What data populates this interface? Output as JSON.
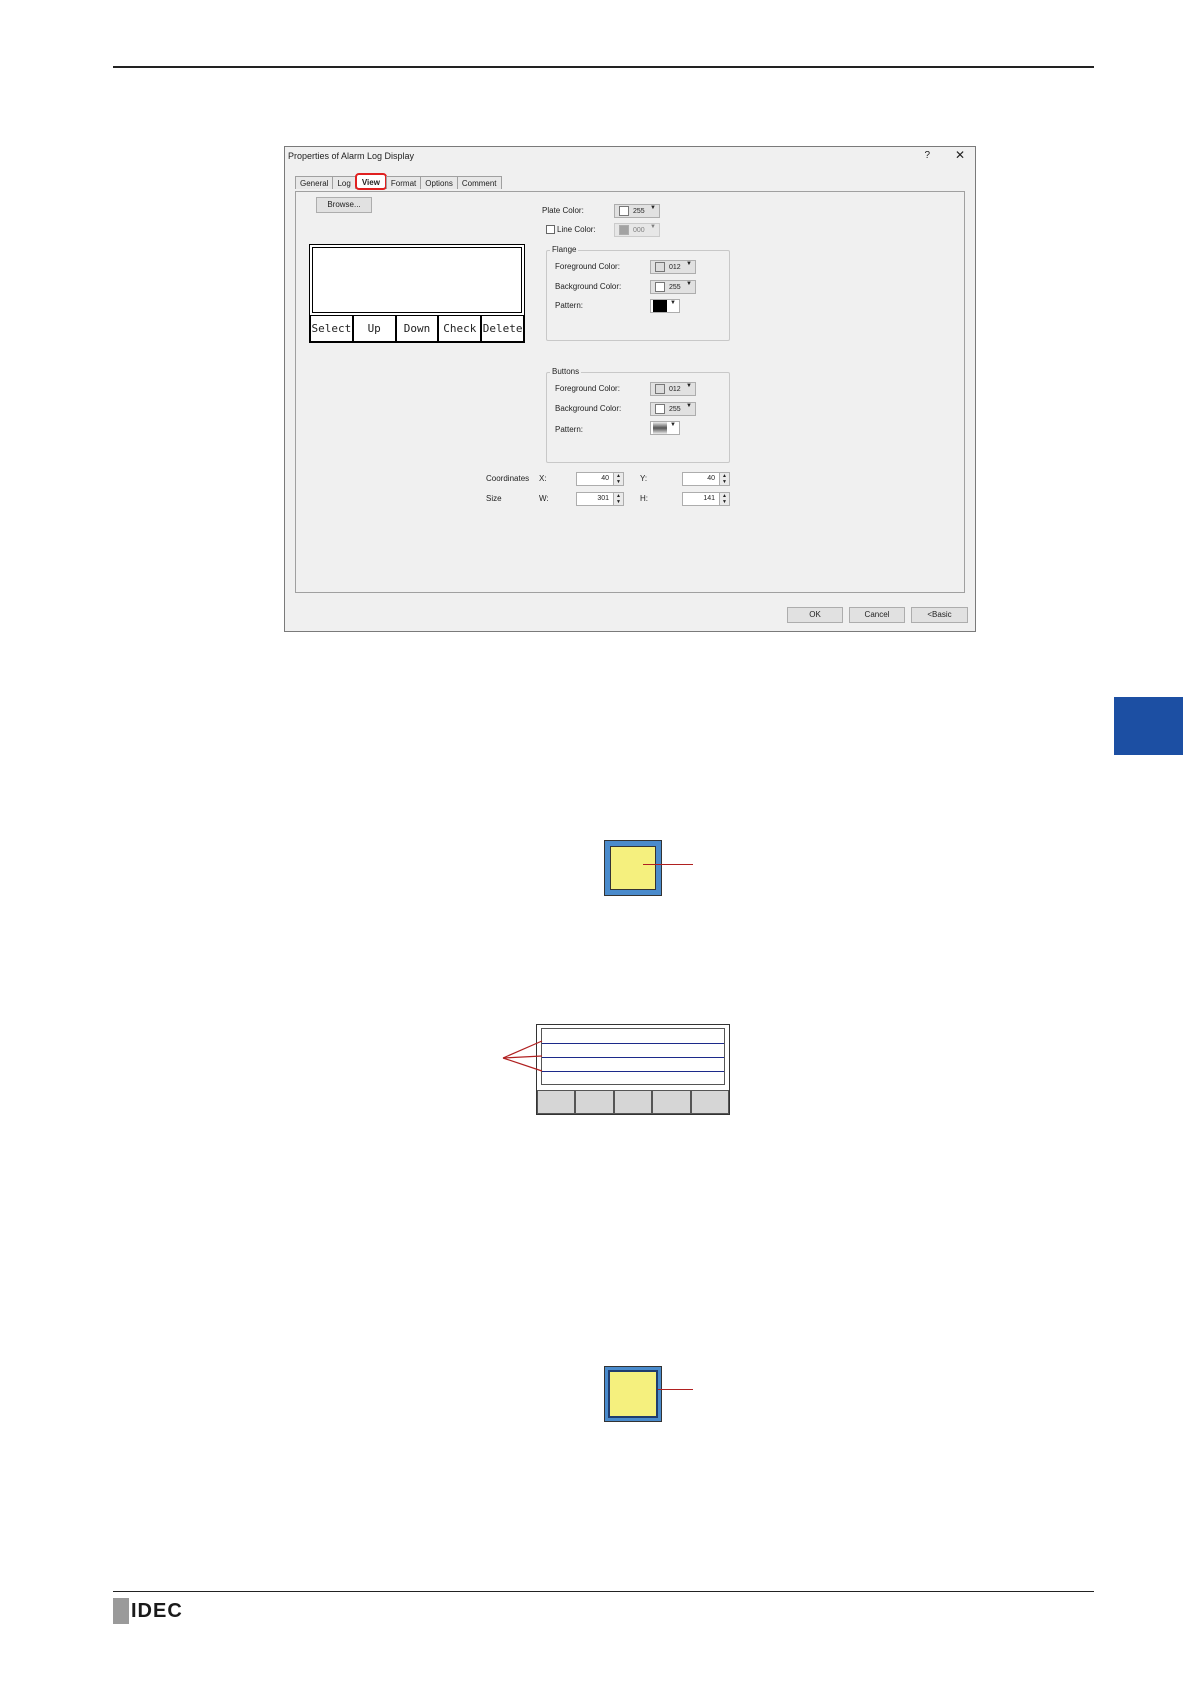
{
  "page": {
    "brand": "IDEC",
    "accent": "#1c4fa3"
  },
  "dialog": {
    "title": "Properties of Alarm Log Display",
    "help": "?",
    "close": "✕",
    "tabs": [
      "General",
      "Log",
      "View",
      "Format",
      "Options",
      "Comment"
    ],
    "active_tab": "View",
    "browse": "Browse...",
    "plate_color_label": "Plate Color:",
    "plate_color_value": "255",
    "line_color_label": "Line Color:",
    "line_color_value": "000",
    "flange": {
      "title": "Flange",
      "fg_label": "Foreground Color:",
      "fg_value": "012",
      "bg_label": "Background Color:",
      "bg_value": "255",
      "pattern_label": "Pattern:"
    },
    "buttons_group": {
      "title": "Buttons",
      "fg_label": "Foreground Color:",
      "fg_value": "012",
      "bg_label": "Background Color:",
      "bg_value": "255",
      "pattern_label": "Pattern:"
    },
    "coordinates_label": "Coordinates",
    "x_label": "X:",
    "x_value": "40",
    "y_label": "Y:",
    "y_value": "40",
    "size_label": "Size",
    "w_label": "W:",
    "w_value": "301",
    "h_label": "H:",
    "h_value": "141",
    "preview_buttons": [
      "Select",
      "Up",
      "Down",
      "Check",
      "Delete"
    ],
    "ok": "OK",
    "cancel": "Cancel",
    "basic": "<Basic"
  }
}
